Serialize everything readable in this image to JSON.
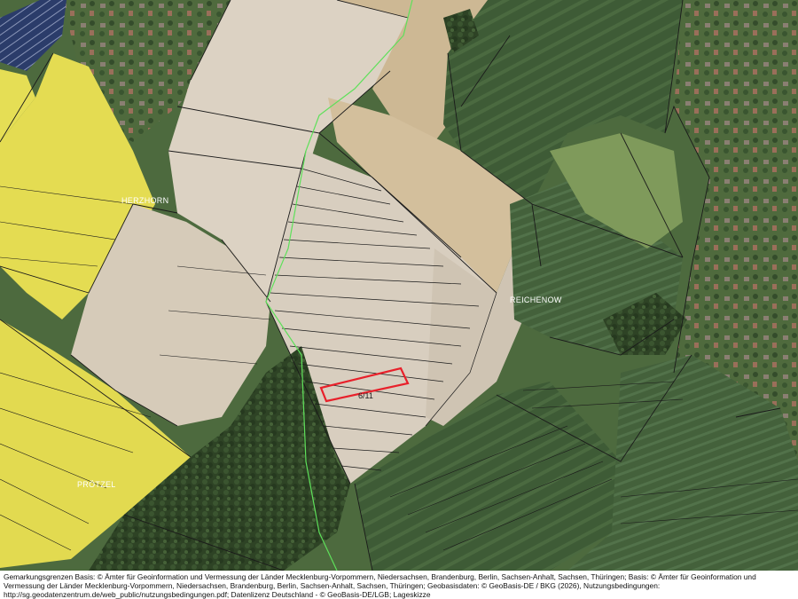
{
  "map": {
    "place_labels": {
      "herzhorn": "HERZHORN",
      "reichenow": "REICHENOW",
      "protzel": "PRÖTZEL"
    },
    "parcel": {
      "label": "6/11",
      "highlight_color": "#e8202a"
    },
    "colors": {
      "field_light": "#d9cfbf",
      "field_tan": "#cbb795",
      "rapeseed": "#e7e05c",
      "grass_dark": "#3d5a35",
      "forest": "#2f4426",
      "parcel_lines": "#1a1a1a",
      "municipal_boundary": "#5ee05a"
    }
  },
  "attribution": {
    "line1": "Gemarkungsgrenzen Basis: © Ämter für Geoinformation und Vermessung der Länder Mecklenburg-Vorpommern, Niedersachsen, Brandenburg, Berlin, Sachsen-Anhalt, Sachsen, Thüringen; Basis: © Ämter für Geoinformation und",
    "line2": "Vermessung der Länder Mecklenburg-Vorpommern, Niedersachsen, Brandenburg, Berlin, Sachsen-Anhalt, Sachsen, Thüringen; Geobasisdaten: © GeoBasis-DE / BKG (2026), Nutzungsbedingungen:",
    "line3": "http://sg.geodatenzentrum.de/web_public/nutzungsbedingungen.pdf; Datenlizenz Deutschland - © GeoBasis-DE/LGB; Lageskizze"
  }
}
